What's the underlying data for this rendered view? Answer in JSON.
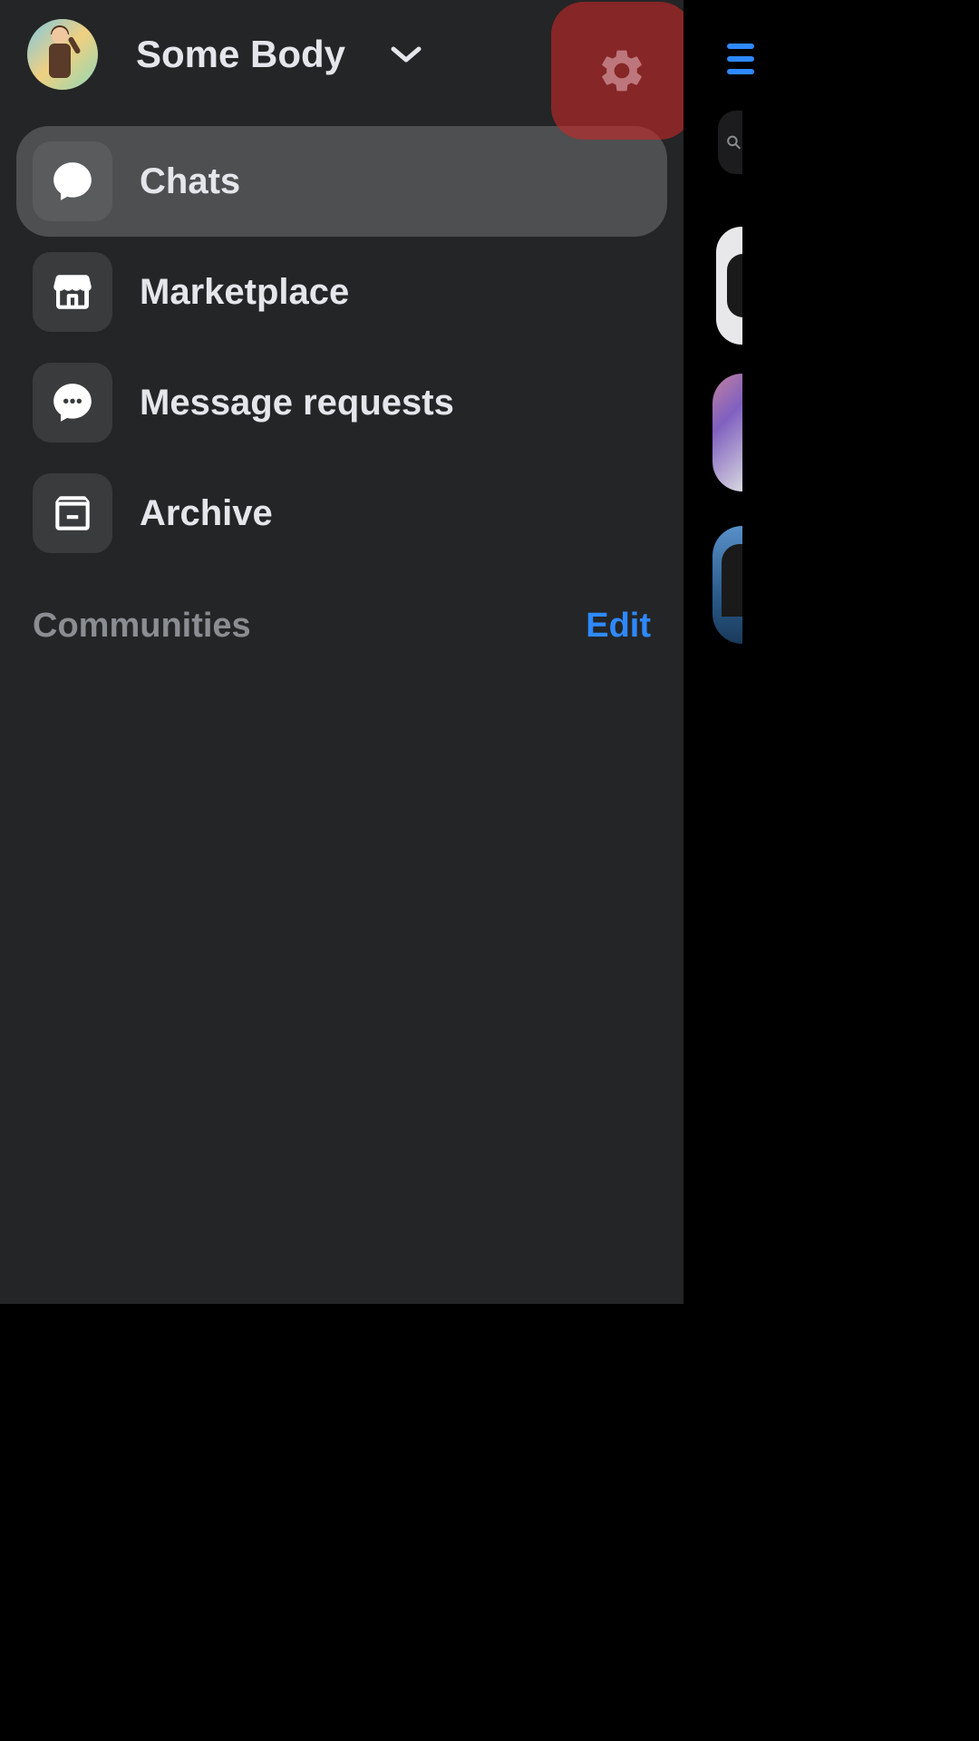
{
  "header": {
    "username": "Some Body"
  },
  "nav": {
    "items": [
      {
        "label": "Chats",
        "icon": "chat-icon",
        "active": true
      },
      {
        "label": "Marketplace",
        "icon": "marketplace-icon",
        "active": false
      },
      {
        "label": "Message requests",
        "icon": "message-requests-icon",
        "active": false
      },
      {
        "label": "Archive",
        "icon": "archive-icon",
        "active": false
      }
    ]
  },
  "section": {
    "title": "Communities",
    "edit_label": "Edit"
  },
  "colors": {
    "accent": "#2e89ff",
    "highlight": "rgba(200,40,40,0.6)"
  }
}
